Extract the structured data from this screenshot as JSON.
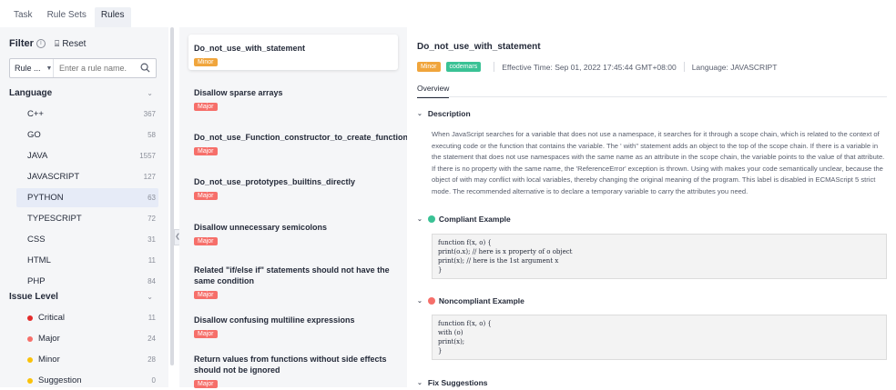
{
  "tabs": [
    {
      "label": "Task"
    },
    {
      "label": "Rule Sets"
    },
    {
      "label": "Rules"
    }
  ],
  "filter": {
    "title": "Filter",
    "reset_label": "Reset",
    "select_value": "Rule ...",
    "search_placeholder": "Enter a rule name.",
    "language_label": "Language",
    "languages": [
      {
        "name": "C++",
        "count": "367"
      },
      {
        "name": "GO",
        "count": "58"
      },
      {
        "name": "JAVA",
        "count": "1557"
      },
      {
        "name": "JAVASCRIPT",
        "count": "127"
      },
      {
        "name": "PYTHON",
        "count": "63"
      },
      {
        "name": "TYPESCRIPT",
        "count": "72"
      },
      {
        "name": "CSS",
        "count": "31"
      },
      {
        "name": "HTML",
        "count": "11"
      },
      {
        "name": "PHP",
        "count": "84"
      }
    ],
    "issue_label": "Issue Level",
    "levels": [
      {
        "name": "Critical",
        "count": "11",
        "color": "#e32b2b"
      },
      {
        "name": "Major",
        "count": "24",
        "color": "#f66f6a"
      },
      {
        "name": "Minor",
        "count": "28",
        "color": "#fac20a"
      },
      {
        "name": "Suggestion",
        "count": "0",
        "color": "#fac20a"
      }
    ]
  },
  "rules": [
    {
      "title": "Do_not_use_with_statement",
      "level": "Minor"
    },
    {
      "title": "Disallow sparse arrays",
      "level": "Major"
    },
    {
      "title": "Do_not_use_Function_constructor_to_create_functions",
      "level": "Major"
    },
    {
      "title": "Do_not_use_prototypes_builtins_directly",
      "level": "Major"
    },
    {
      "title": "Disallow unnecessary semicolons",
      "level": "Major"
    },
    {
      "title": "Related \"if/else if\" statements should not have the same condition",
      "level": "Major"
    },
    {
      "title": "Disallow confusing multiline expressions",
      "level": "Major"
    },
    {
      "title": "Return values from functions without side effects should not be ignored",
      "level": "Major"
    }
  ],
  "colors": {
    "minor": "#f0a53c",
    "major": "#f66f6a",
    "codemars": "#3ac295"
  },
  "detail": {
    "title": "Do_not_use_with_statement",
    "level": "Minor",
    "tool": "codemars",
    "effective_time": "Effective Time: Sep 01, 2022 17:45:44 GMT+08:00",
    "language": "Language: JAVASCRIPT",
    "tab": "Overview",
    "description_label": "Description",
    "description": "When JavaScript searches for a variable that does not use a namespace, it searches for it through a scope chain, which is related to the context of executing code or the function that contains the variable. The ' with'' statement adds an object to the top of the scope chain. If there is a variable in the statement that does not use namespaces with the same name as an attribute in the scope chain, the variable points to the value of that attribute. If there is no property with the same name, the 'ReferenceError' exception is thrown. Using with makes your code semantically unclear, because the object of with may conflict with local variables, thereby changing the original meaning of the program. This label is disabled in ECMAScript 5 strict mode. The recommended alternative is to declare a temporary variable to carry the attributes you need.",
    "compliant_label": "Compliant Example",
    "compliant_code": [
      "function f(x, o) {",
      "print(o.x); // here is x property of o object",
      "print(x); // here is the 1st argument x",
      "}"
    ],
    "noncompliant_label": "Noncompliant Example",
    "noncompliant_code": [
      "function f(x, o) {",
      "with (o)",
      "print(x);",
      "}"
    ],
    "fix_label": "Fix Suggestions"
  }
}
